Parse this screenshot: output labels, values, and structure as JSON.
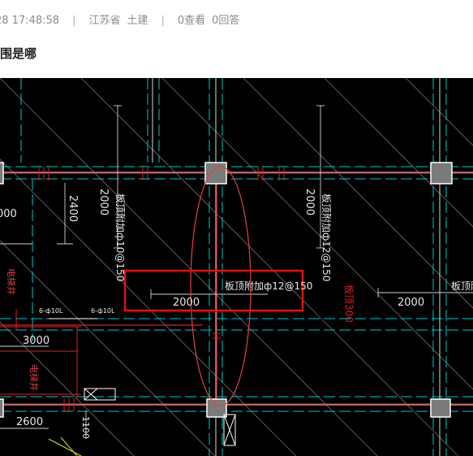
{
  "question_meta": {
    "time": "28 17:48:58",
    "separator": "|",
    "province": "江苏省",
    "category": "土建",
    "views": "0查看",
    "answers": "0回答"
  },
  "question_title": "围是哪",
  "drawing": {
    "dims": {
      "d2000_top_left": "2000",
      "d2400": "2400",
      "d000": "000",
      "d2000_top_mid": "2000",
      "d2000_box": "2000",
      "d2000_right": "2000",
      "d3000": "3000",
      "d2600": "2600",
      "d1100": "1100"
    },
    "labels": {
      "rebar_left": "板顶附加ф10@150",
      "rebar_mid": "板顶附加ф12@150",
      "rebar_box": "板顶附加ф12@150",
      "rebar_right": "板顶附",
      "red_label": "板顶300",
      "small_a": "6-ф10L",
      "small_b": "6-ф10L",
      "shaft_a": "电梯井",
      "shaft_b": "电梯井"
    }
  }
}
